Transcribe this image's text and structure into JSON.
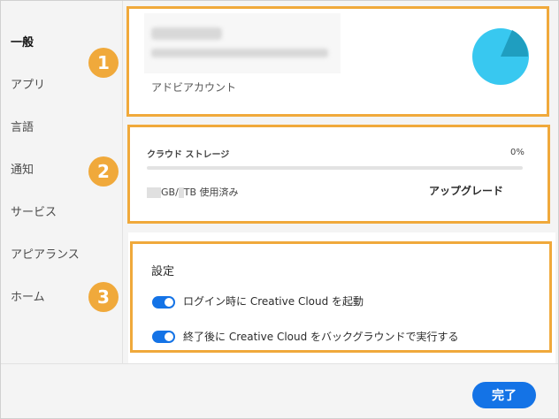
{
  "sidebar": {
    "items": [
      {
        "label": "一般",
        "active": true
      },
      {
        "label": "アプリ"
      },
      {
        "label": "言語"
      },
      {
        "label": "通知"
      },
      {
        "label": "サービス"
      },
      {
        "label": "アピアランス"
      },
      {
        "label": "ホーム"
      }
    ]
  },
  "account": {
    "label": "アドビアカウント",
    "avatar_colors": [
      "#38c8f0",
      "#1f9ec0"
    ]
  },
  "storage": {
    "title": "クラウド ストレージ",
    "percent": "0%",
    "percent_value": 0,
    "usage_gb_unit": "GB/",
    "usage_tb_text": "TB 使用済み",
    "upgrade": "アップグレード"
  },
  "settings": {
    "title": "設定",
    "toggles": [
      {
        "label": "ログイン時に Creative Cloud を起動",
        "on": true
      },
      {
        "label": "終了後に Creative Cloud をバックグラウンドで実行する",
        "on": true
      }
    ]
  },
  "steps": [
    "1",
    "2",
    "3"
  ],
  "footer": {
    "done": "完了"
  },
  "colors": {
    "highlight": "#f0a93b",
    "accent": "#1473e6"
  }
}
